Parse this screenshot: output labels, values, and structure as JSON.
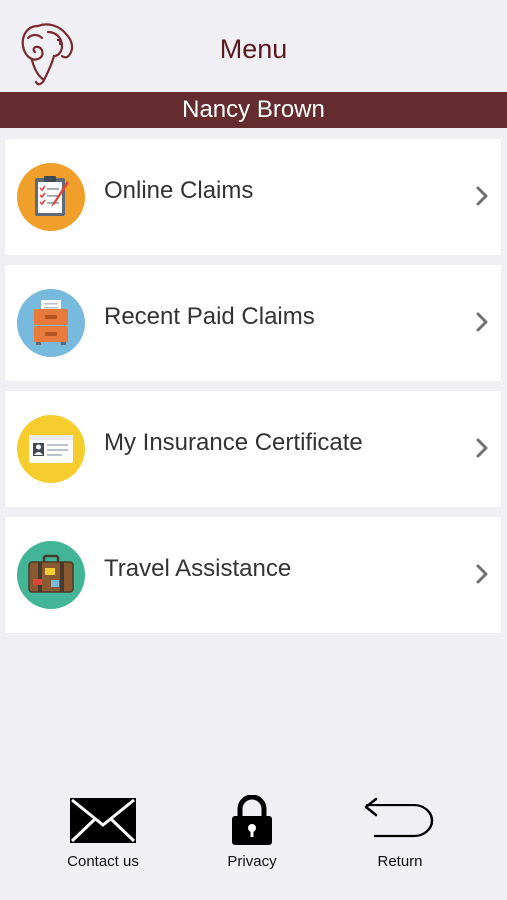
{
  "header": {
    "title": "Menu",
    "logo_icon": "ram-head-logo-icon"
  },
  "user": {
    "name": "Nancy Brown"
  },
  "menu": {
    "items": [
      {
        "label": "Online Claims",
        "icon": "clipboard-checklist-icon",
        "color": "#f0a02a"
      },
      {
        "label": "Recent Paid Claims",
        "icon": "file-cabinet-icon",
        "color": "#78b9de"
      },
      {
        "label": "My Insurance Certificate",
        "icon": "id-card-icon",
        "color": "#f6cd2d"
      },
      {
        "label": "Travel Assistance",
        "icon": "suitcase-icon",
        "color": "#43b597"
      }
    ]
  },
  "footer": {
    "contact_label": "Contact us",
    "privacy_label": "Privacy",
    "return_label": "Return"
  },
  "colors": {
    "brand": "#652c2f",
    "background": "#efeff4"
  }
}
